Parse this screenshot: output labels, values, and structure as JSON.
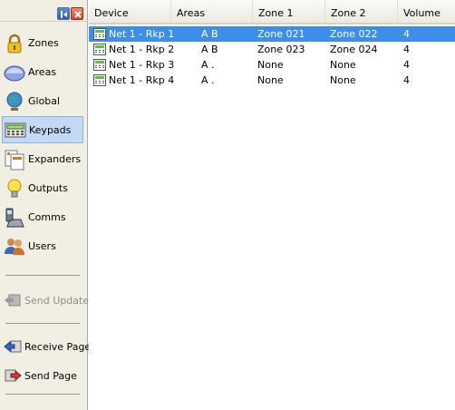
{
  "sidebar": {
    "nav": [
      {
        "label": "Zones",
        "icon": "lock-icon"
      },
      {
        "label": "Areas",
        "icon": "area-icon"
      },
      {
        "label": "Global",
        "icon": "globe-icon"
      },
      {
        "label": "Keypads",
        "icon": "keypad-icon"
      },
      {
        "label": "Expanders",
        "icon": "expander-icon"
      },
      {
        "label": "Outputs",
        "icon": "lightbulb-icon"
      },
      {
        "label": "Comms",
        "icon": "phone-icon"
      },
      {
        "label": "Users",
        "icon": "users-icon"
      }
    ],
    "active": "Keypads",
    "actions": [
      {
        "label": "Send Update",
        "icon": "send-update-icon",
        "enabled": false
      },
      {
        "label": "Receive Page",
        "icon": "receive-page-icon",
        "enabled": true
      },
      {
        "label": "Send Page",
        "icon": "send-page-icon",
        "enabled": true
      }
    ]
  },
  "table": {
    "columns": [
      "Device",
      "Areas",
      "Zone 1",
      "Zone 2",
      "Volume"
    ],
    "rows": [
      {
        "device": "Net 1 - Rkp 1",
        "areas": "A B",
        "zone1": "Zone 021",
        "zone2": "Zone 022",
        "volume": "4",
        "selected": true
      },
      {
        "device": "Net 1 - Rkp 2",
        "areas": "A B",
        "zone1": "Zone 023",
        "zone2": "Zone 024",
        "volume": "4",
        "selected": false
      },
      {
        "device": "Net 1 - Rkp 3",
        "areas": "A .",
        "zone1": "None",
        "zone2": "None",
        "volume": "4",
        "selected": false
      },
      {
        "device": "Net 1 - Rkp 4",
        "areas": "A .",
        "zone1": "None",
        "zone2": "None",
        "volume": "4",
        "selected": false
      }
    ]
  },
  "colors": {
    "selection": "#3d8ee9",
    "sidebar_bg": "#f1efe3",
    "active_nav": "#c3d9f4"
  }
}
